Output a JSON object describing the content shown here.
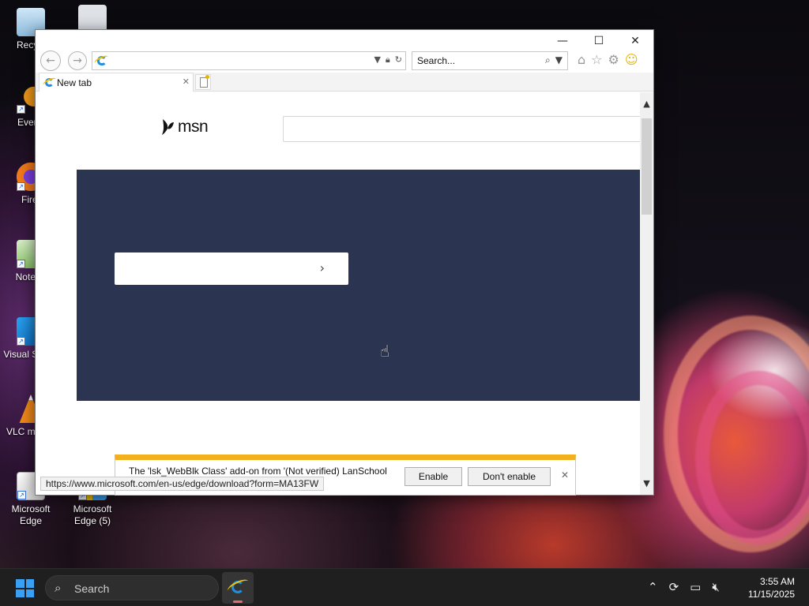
{
  "desktop": {
    "icons": [
      {
        "label": "Recycl"
      },
      {
        "label": "Everyt"
      },
      {
        "label": "Firef"
      },
      {
        "label": "Notepa"
      },
      {
        "label": "Visual S Cod"
      },
      {
        "label": "VLC m play"
      },
      {
        "label": "Microsoft Edge"
      },
      {
        "label": "Microsoft Edge (5)"
      }
    ]
  },
  "browser": {
    "window_controls": {
      "minimize": "—",
      "maximize": "☐",
      "close": "✕"
    },
    "address": {
      "value": ""
    },
    "search": {
      "placeholder": "Search..."
    },
    "tab": {
      "label": "New tab"
    },
    "msn_logo_text": "msn",
    "status_url": "https://www.microsoft.com/en-us/edge/download?form=MA13FW",
    "notification": {
      "message": "The 'lsk_WebBlk Class' add-on from '(Not verified) LanSchool",
      "enable_label": "Enable",
      "dont_enable_label": "Don't enable"
    }
  },
  "taskbar": {
    "search_label": "Search",
    "time": "3:55 AM",
    "date": "11/15/2025"
  },
  "colors": {
    "hero_bg": "#2b3552",
    "notify_accent": "#f2b01e",
    "start_blue": "#3aa0f3"
  }
}
